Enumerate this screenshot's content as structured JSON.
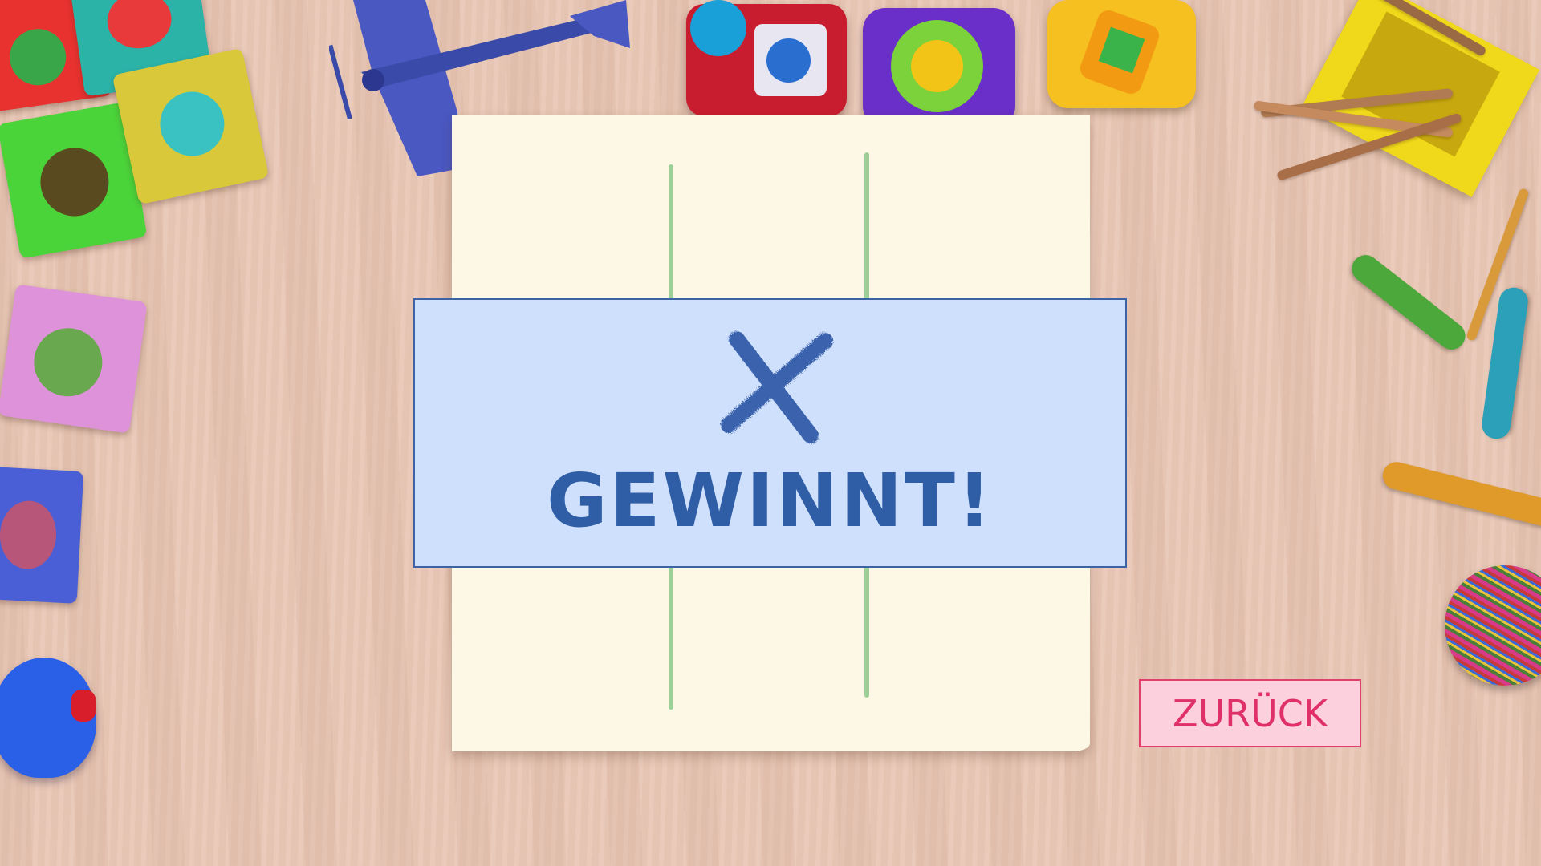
{
  "game": {
    "winner_symbol": "X",
    "result_text": "GEWINNT!",
    "back_label": "ZURÜCK"
  },
  "colors": {
    "banner_background": "#cfe0fd",
    "banner_border": "#3c62a8",
    "win_text": "#2f5ea6",
    "x_mark": "#3a64ad",
    "board_lines": "#8cc98a",
    "paper": "#fdf7e6",
    "back_button_background": "#fcd0dc",
    "back_button_text": "#e0306a",
    "table": "#e8c6b4"
  },
  "decorations": [
    "foam-puzzle-mat",
    "toy-airplane",
    "toy-train",
    "pencil-cup",
    "crayons",
    "yarn-ball",
    "rubber-duck"
  ]
}
